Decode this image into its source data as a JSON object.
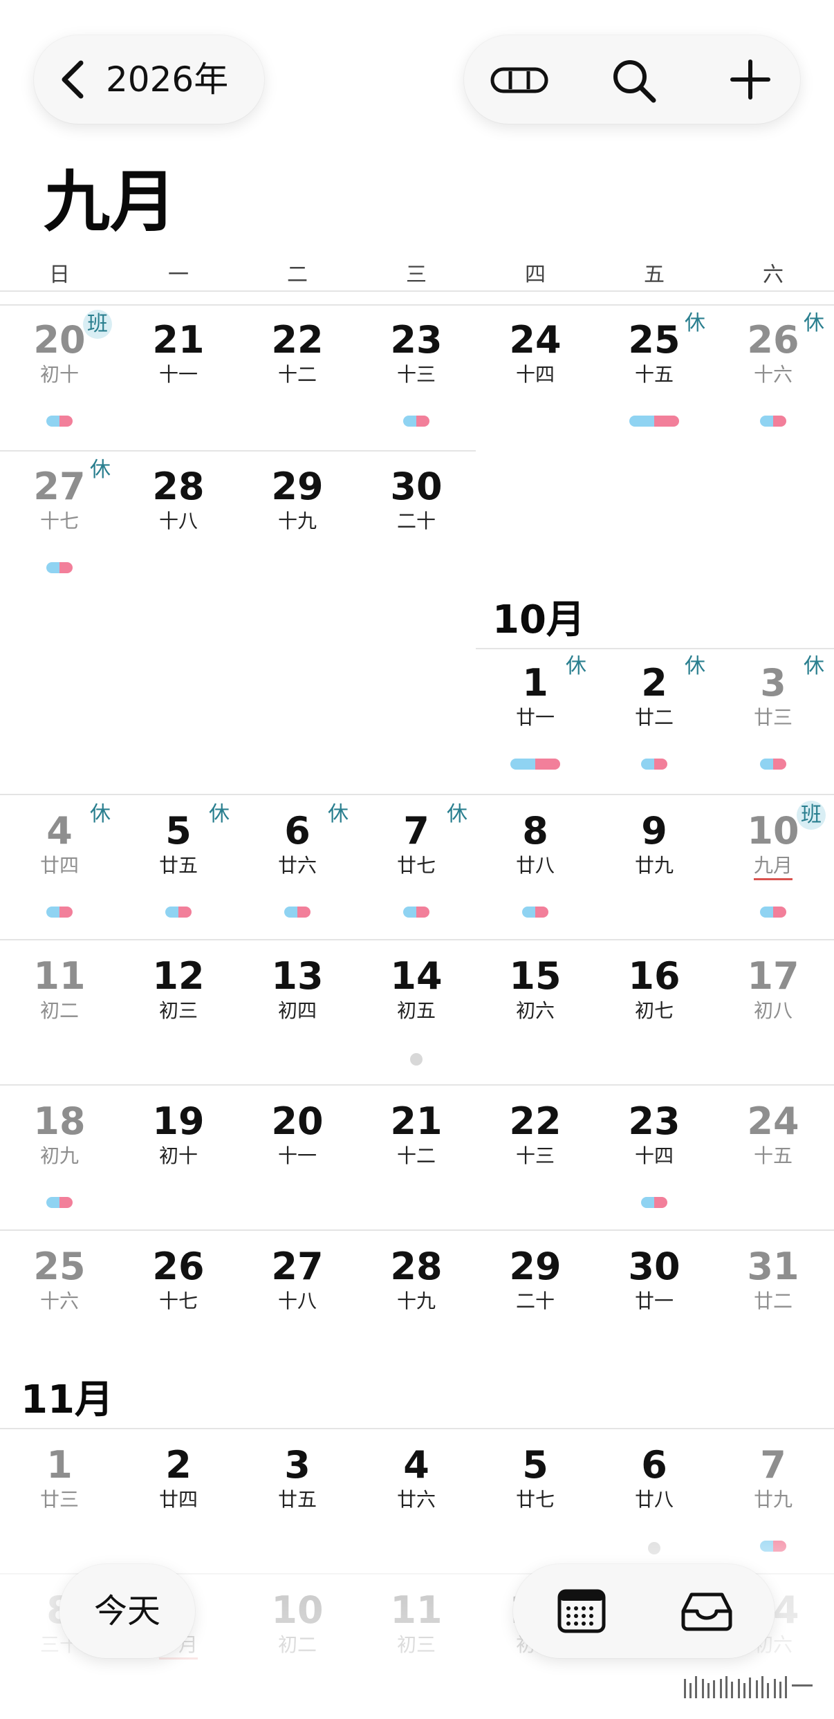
{
  "header": {
    "back_icon": "chevron-left-icon",
    "year_label": "2026年",
    "view_mode_icon": "capsule-toggle-icon",
    "search_icon": "search-icon",
    "add_icon": "plus-icon"
  },
  "month_title": "九月",
  "weekdays": [
    "日",
    "一",
    "二",
    "三",
    "四",
    "五",
    "六"
  ],
  "tags": {
    "rest": "休",
    "work": "班"
  },
  "month_labels": {
    "october": "10月",
    "november": "11月"
  },
  "weeks": [
    {
      "days": [
        {
          "n": "20",
          "l": "初十",
          "tag": "班",
          "evt": "small"
        },
        {
          "n": "21",
          "l": "十一"
        },
        {
          "n": "22",
          "l": "十二"
        },
        {
          "n": "23",
          "l": "十三",
          "evt": "small"
        },
        {
          "n": "24",
          "l": "十四"
        },
        {
          "n": "25",
          "l": "十五",
          "tag": "休",
          "evt": "wide"
        },
        {
          "n": "26",
          "l": "十六",
          "tag": "休",
          "evt": "small"
        }
      ]
    },
    {
      "days": [
        {
          "n": "27",
          "l": "十七",
          "tag": "休",
          "evt": "small"
        },
        {
          "n": "28",
          "l": "十八"
        },
        {
          "n": "29",
          "l": "十九"
        },
        {
          "n": "30",
          "l": "二十"
        }
      ]
    },
    {
      "days": [
        {
          "n": "1",
          "l": "廿一",
          "tag": "休",
          "evt": "wide"
        },
        {
          "n": "2",
          "l": "廿二",
          "tag": "休",
          "evt": "small"
        },
        {
          "n": "3",
          "l": "廿三",
          "tag": "休",
          "evt": "small"
        }
      ]
    },
    {
      "days": [
        {
          "n": "4",
          "l": "廿四",
          "tag": "休",
          "evt": "small"
        },
        {
          "n": "5",
          "l": "廿五",
          "tag": "休",
          "evt": "small"
        },
        {
          "n": "6",
          "l": "廿六",
          "tag": "休",
          "evt": "small"
        },
        {
          "n": "7",
          "l": "廿七",
          "tag": "休",
          "evt": "small"
        },
        {
          "n": "8",
          "l": "廿八",
          "evt": "small"
        },
        {
          "n": "9",
          "l": "廿九"
        },
        {
          "n": "10",
          "l": "九月",
          "tag": "班",
          "evt": "small",
          "ul": true
        }
      ]
    },
    {
      "days": [
        {
          "n": "11",
          "l": "初二"
        },
        {
          "n": "12",
          "l": "初三"
        },
        {
          "n": "13",
          "l": "初四"
        },
        {
          "n": "14",
          "l": "初五",
          "evt": "dot"
        },
        {
          "n": "15",
          "l": "初六"
        },
        {
          "n": "16",
          "l": "初七"
        },
        {
          "n": "17",
          "l": "初八"
        }
      ]
    },
    {
      "days": [
        {
          "n": "18",
          "l": "初九",
          "evt": "small"
        },
        {
          "n": "19",
          "l": "初十"
        },
        {
          "n": "20",
          "l": "十一"
        },
        {
          "n": "21",
          "l": "十二"
        },
        {
          "n": "22",
          "l": "十三"
        },
        {
          "n": "23",
          "l": "十四",
          "evt": "small"
        },
        {
          "n": "24",
          "l": "十五"
        }
      ]
    },
    {
      "days": [
        {
          "n": "25",
          "l": "十六"
        },
        {
          "n": "26",
          "l": "十七"
        },
        {
          "n": "27",
          "l": "十八"
        },
        {
          "n": "28",
          "l": "十九"
        },
        {
          "n": "29",
          "l": "二十"
        },
        {
          "n": "30",
          "l": "廿一"
        },
        {
          "n": "31",
          "l": "廿二"
        }
      ]
    },
    {
      "days": [
        {
          "n": "1",
          "l": "廿三"
        },
        {
          "n": "2",
          "l": "廿四"
        },
        {
          "n": "3",
          "l": "廿五"
        },
        {
          "n": "4",
          "l": "廿六"
        },
        {
          "n": "5",
          "l": "廿七"
        },
        {
          "n": "6",
          "l": "廿八",
          "evt": "dot"
        },
        {
          "n": "7",
          "l": "廿九",
          "evt": "small"
        }
      ]
    },
    {
      "days": [
        {
          "n": "8",
          "l": "三十"
        },
        {
          "n": "9",
          "l": "十月",
          "ul": true
        },
        {
          "n": "10",
          "l": "初二"
        },
        {
          "n": "11",
          "l": "初三"
        },
        {
          "n": "12",
          "l": "初四"
        },
        {
          "n": "13",
          "l": "初五"
        },
        {
          "n": "14",
          "l": "初六"
        }
      ]
    }
  ],
  "bottom_bar": {
    "today_label": "今天",
    "calendar_icon": "calendar-grid-icon",
    "inbox_icon": "inbox-tray-icon"
  },
  "colors": {
    "rest_tag": "#2a7f8f",
    "work_tag_bg": "#d9eef4",
    "event_blue": "#8fd3f2",
    "event_pink": "#f27f9a",
    "weekend_text": "#8e8e8e"
  }
}
